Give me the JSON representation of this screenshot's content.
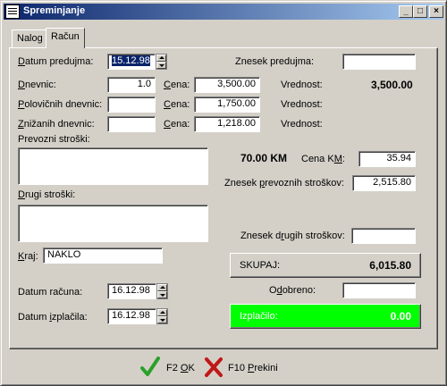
{
  "window": {
    "title": "Spreminjanje",
    "minimize_glyph": "_",
    "maximize_glyph": "□",
    "close_glyph": "×"
  },
  "tabs": [
    {
      "label": "Nalog"
    },
    {
      "label": "Račun"
    }
  ],
  "left": {
    "datum_predujma": {
      "label_pre": "D",
      "label_rest": "atum predujma:",
      "value": "15.12.98"
    },
    "dnevnic": {
      "label_pre": "D",
      "label_rest": "nevnic:",
      "value": "1.0"
    },
    "polovicnih": {
      "label_pre": "P",
      "label_rest": "olovičnih dnevnic:",
      "value": ""
    },
    "znizanih": {
      "label_pre": "Z",
      "label_rest": "nižanih dnevnic:",
      "value": ""
    },
    "cena_label_pre": "C",
    "cena_label_rest": "ena:",
    "cena_values": [
      "3,500.00",
      "1,750.00",
      "1,218.00"
    ],
    "vrednost_label": "Vrednost:",
    "vrednost_values": [
      "3,500.00",
      "",
      ""
    ],
    "prevozni_label": "Prevozni stroški:",
    "drugi_label_pre": "D",
    "drugi_label_mid": "r",
    "drugi_label_rest": "ugi stroški:",
    "kraj": {
      "label_pre": "K",
      "label_rest": "raj:",
      "value": "NAKLO"
    },
    "datum_racuna": {
      "label": "Datum računa:",
      "value": "16.12.98"
    },
    "datum_izplacila": {
      "label_pre": "Datum ",
      "label_u": "i",
      "label_rest": "zplačila:",
      "value": "16.12.98"
    }
  },
  "right": {
    "znesek_predujma": {
      "label": "Znesek predujma:",
      "value": ""
    },
    "km": "70.00 KM",
    "cena_km": {
      "label_pre": "Cena K",
      "label_u": "M",
      "label_rest": ":",
      "value": "35.94"
    },
    "znesek_prevoznih": {
      "label_pre": "Znesek ",
      "label_u": "p",
      "label_rest": "revoznih stroškov:",
      "value": "2,515.80"
    },
    "znesek_drugih": {
      "label_pre": "Znesek d",
      "label_u": "r",
      "label_rest": "ugih stroškov:",
      "value": ""
    },
    "skupaj": {
      "label": "SKUPAJ:",
      "value": "6,015.80"
    },
    "odobreno": {
      "label_pre": "O",
      "label_u": "d",
      "label_rest": "obreno:",
      "value": ""
    },
    "izplacilo": {
      "label": "Izplačilo:",
      "value": "0.00"
    }
  },
  "footer": {
    "ok_pre": "F2 ",
    "ok_u": "O",
    "ok_rest": "K",
    "cancel_pre": "F10 ",
    "cancel_u": "P",
    "cancel_rest": "rekini"
  },
  "colors": {
    "titlebar_start": "#0a246a",
    "titlebar_end": "#a6caf0",
    "face": "#d4d0c8",
    "izplacilo_bg": "#00ff00",
    "ok_check": "#2aa02a",
    "cancel_x": "#c01818"
  }
}
